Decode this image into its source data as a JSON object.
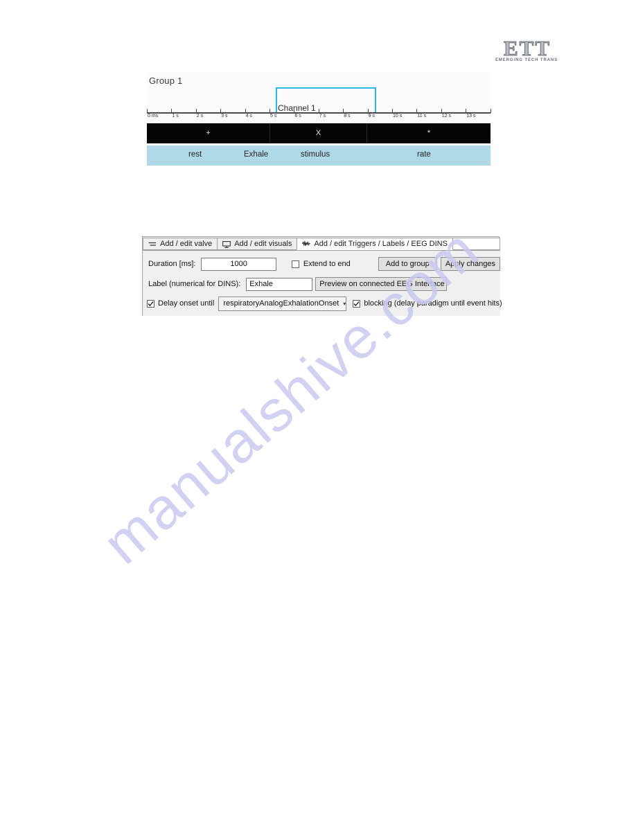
{
  "logo": {
    "letters": [
      "E",
      "T",
      "T"
    ],
    "tagline": "EMERGING TECH TRANS"
  },
  "watermark": {
    "text": "manualshive.com"
  },
  "timeline": {
    "group_label": "Group 1",
    "channel_label": "Channel 1",
    "tick_labels": [
      "0 ms",
      "1 s",
      "2 s",
      "3 s",
      "4 s",
      "5 s",
      "6 s",
      "7 s",
      "8 s",
      "9 s",
      "10 s",
      "11 s",
      "12 s",
      "13 s"
    ],
    "visual_segments": [
      {
        "symbol": "+"
      },
      {
        "symbol": "X"
      },
      {
        "symbol": "*"
      }
    ],
    "label_bar": [
      {
        "text": "rest"
      },
      {
        "text": "Exhale"
      },
      {
        "text": "stimulus"
      },
      {
        "text": "rate"
      }
    ],
    "colors": {
      "channel_box": "#27b7e8",
      "visual_bar": "#050505",
      "label_bar": "#b0d9e8"
    }
  },
  "panel": {
    "tabs": [
      {
        "label": "Add / edit valve",
        "icon": "lines-icon",
        "active": false
      },
      {
        "label": "Add / edit visuals",
        "icon": "monitor-icon",
        "active": false
      },
      {
        "label": "Add / edit Triggers / Labels / EEG DINS",
        "icon": "waveform-icon",
        "active": true
      }
    ],
    "duration": {
      "label": "Duration [ms]:",
      "value": "1000"
    },
    "extend_to_end": {
      "label": "Extend to end",
      "checked": false
    },
    "add_to_group_label": "Add to group",
    "apply_changes_label": "Apply changes",
    "label_field": {
      "label": "Label (numerical for DINS):",
      "value": "Exhale"
    },
    "preview_label": "Preview on connected EEG Interface",
    "delay_onset": {
      "label": "Delay onset until",
      "checked": true,
      "selected": "respiratoryAnalogExhalationOnset"
    },
    "blocking": {
      "label": "blocking (delay paradigm until event hits)",
      "checked": true
    }
  }
}
